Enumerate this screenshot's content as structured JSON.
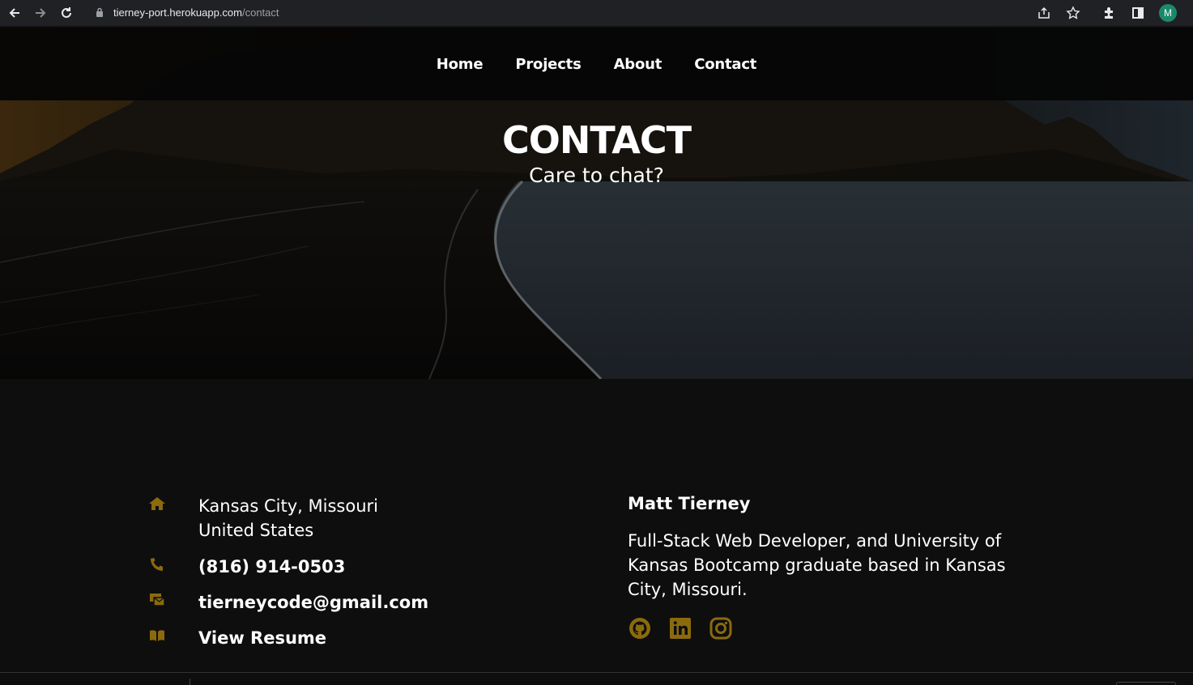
{
  "browser": {
    "url_host": "tierney-port.herokuapp.com",
    "url_path": "/contact",
    "profile_initial": "M"
  },
  "nav": {
    "items": [
      {
        "label": "Home"
      },
      {
        "label": "Projects"
      },
      {
        "label": "About"
      },
      {
        "label": "Contact"
      }
    ]
  },
  "hero": {
    "title": "CONTACT",
    "subtitle": "Care to chat?"
  },
  "contact": {
    "address_line1": "Kansas City, Missouri",
    "address_line2": "United States",
    "phone": "(816) 914-0503",
    "email": "tierneycode@gmail.com",
    "resume": "View Resume"
  },
  "bio": {
    "name": "Matt Tierney",
    "text": "Full-Stack Web Developer, and University of Kansas Bootcamp graduate based in Kansas City, Missouri."
  },
  "socials": [
    {
      "icon": "github-icon"
    },
    {
      "icon": "linkedin-icon"
    },
    {
      "icon": "instagram-icon"
    }
  ],
  "colors": {
    "accent": "#8a6a0c",
    "background": "#0e0e0f",
    "navbar": "#050505"
  }
}
